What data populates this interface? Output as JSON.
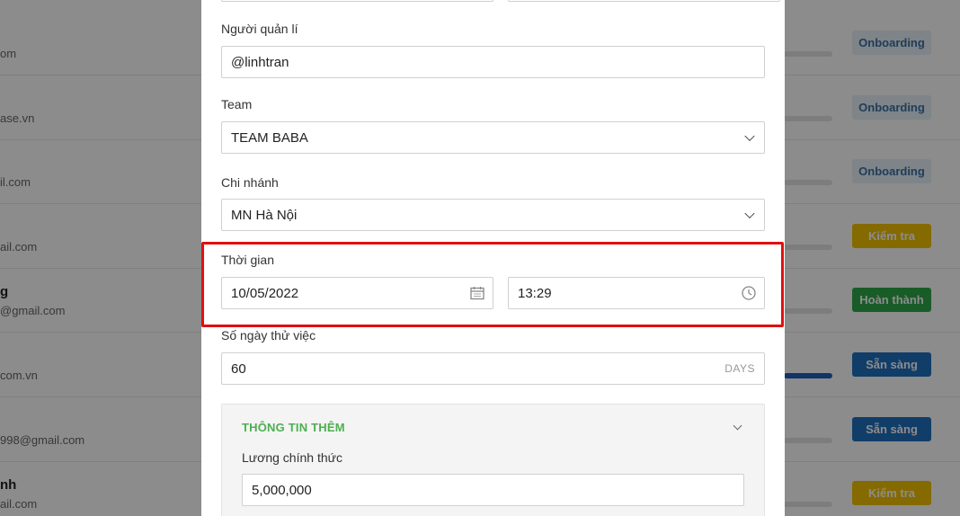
{
  "background_list": {
    "rows": [
      {
        "name": "",
        "email": "om",
        "progress": 0,
        "status": "Onboarding",
        "status_bg": "#e6f0f8",
        "status_fg": "#3b6fa0"
      },
      {
        "name": "",
        "email": "ase.vn",
        "progress": 0,
        "status": "Onboarding",
        "status_bg": "#e6f0f8",
        "status_fg": "#3b6fa0"
      },
      {
        "name": "",
        "email": "il.com",
        "progress": 0,
        "status": "Onboarding",
        "status_bg": "#e6f0f8",
        "status_fg": "#3b6fa0"
      },
      {
        "name": "",
        "email": "ail.com",
        "progress": 0,
        "status": "Kiểm tra",
        "status_bg": "#f2c200",
        "status_fg": "#ffffff"
      },
      {
        "name": "g",
        "email": "@gmail.com",
        "progress": 0,
        "status": "Hoàn thành",
        "status_bg": "#2ea84a",
        "status_fg": "#ffffff"
      },
      {
        "name": "",
        "email": "com.vn",
        "progress": 1,
        "status": "Sẵn sàng",
        "status_bg": "#1f6fc0",
        "status_fg": "#ffffff"
      },
      {
        "name": "",
        "email": "998@gmail.com",
        "progress": 0,
        "status": "Sẵn sàng",
        "status_bg": "#1f6fc0",
        "status_fg": "#ffffff"
      },
      {
        "name": "nh",
        "email": "ail.com",
        "progress": 0,
        "status": "Kiểm tra",
        "status_bg": "#f2c200",
        "status_fg": "#ffffff"
      }
    ]
  },
  "form": {
    "manager": {
      "label": "Người quản lí",
      "value": "@linhtran"
    },
    "team": {
      "label": "Team",
      "value": "TEAM BABA"
    },
    "branch": {
      "label": "Chi nhánh",
      "value": "MN Hà Nội"
    },
    "time": {
      "label": "Thời gian",
      "date": "10/05/2022",
      "clock": "13:29",
      "date_icon": "calendar-icon",
      "clock_icon": "clock-icon"
    },
    "probation": {
      "label": "Số ngày thử việc",
      "value": "60",
      "suffix": "DAYS"
    },
    "extra": {
      "title": "THÔNG TIN THÊM",
      "salary_label": "Lương chính thức",
      "salary_value": "5,000,000"
    }
  },
  "colors": {
    "highlight": "#e01010",
    "accent_green": "#4caf50"
  }
}
